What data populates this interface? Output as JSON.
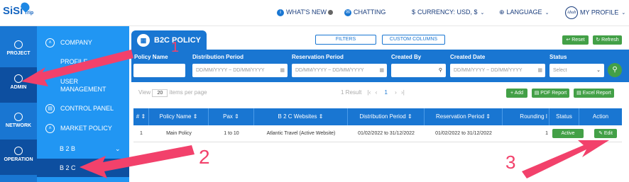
{
  "brand": {
    "name": "SiSi",
    "sub": "Trip"
  },
  "topnav": {
    "whats_new": "WHAT'S NEW",
    "chatting": "CHATTING",
    "currency": "CURRENCY: USD, $",
    "language": "LANGUAGE",
    "profile": "MY PROFILE",
    "avatar_text": "Ahab"
  },
  "sidebar_main": [
    {
      "label": "PROJECT",
      "icon": "home-icon"
    },
    {
      "label": "ADMIN",
      "icon": "admin-icon"
    },
    {
      "label": "NETWORK",
      "icon": "network-icon"
    },
    {
      "label": "OPERATION",
      "icon": "operation-icon"
    }
  ],
  "sidebar_sub": {
    "company": "COMPANY",
    "profile": "PROFILE",
    "user_mgmt_1": "USER",
    "user_mgmt_2": "MANAGEMENT",
    "control_panel": "CONTROL PANEL",
    "market_policy": "MARKET POLICY",
    "b2b": "B 2 B",
    "b2c": "B 2 C"
  },
  "panel": {
    "tab": "B2C POLICY",
    "filters": "FILTERS",
    "custom_columns": "CUSTOM COLUMNS",
    "reset": "Reset",
    "refresh": "Refresh"
  },
  "filters": {
    "policy_name": "Policy Name",
    "distribution_period": "Distribution Period",
    "reservation_period": "Reservation Period",
    "created_by": "Created By",
    "created_date": "Created Date",
    "status": "Status",
    "date_placeholder": "DD/MM/YYYY ~ DD/MM/YYYY",
    "status_placeholder": "Select"
  },
  "paging": {
    "view": "View",
    "page_size": "20",
    "items_per_page": "items per page",
    "result": "1 Result",
    "current_page": "1",
    "add": "Add",
    "pdf": "PDF Report",
    "excel": "Excel Report"
  },
  "table": {
    "headers": [
      "#",
      "Policy Name",
      "Pax",
      "B 2 C Websites",
      "Distribution Period",
      "Reservation Period",
      "Rounding I",
      "Status",
      "Action"
    ],
    "rows": [
      {
        "num": "1",
        "policy_name": "Main Policy",
        "pax": "1 to 10",
        "website": "Atlantic Travel (Active Website)",
        "distribution": "01/02/2022 to 31/12/2022",
        "reservation": "01/02/2022 to 31/12/2022",
        "rounding": "1",
        "status": "Active",
        "action": "Edit"
      }
    ]
  },
  "annotations": {
    "a1": "1",
    "a2": "2",
    "a3": "3"
  },
  "colors": {
    "primary": "#1976d2",
    "sidebar_light": "#2196f3",
    "active": "#0d4fa0",
    "green": "#43a047",
    "annotation": "#f2416b"
  }
}
